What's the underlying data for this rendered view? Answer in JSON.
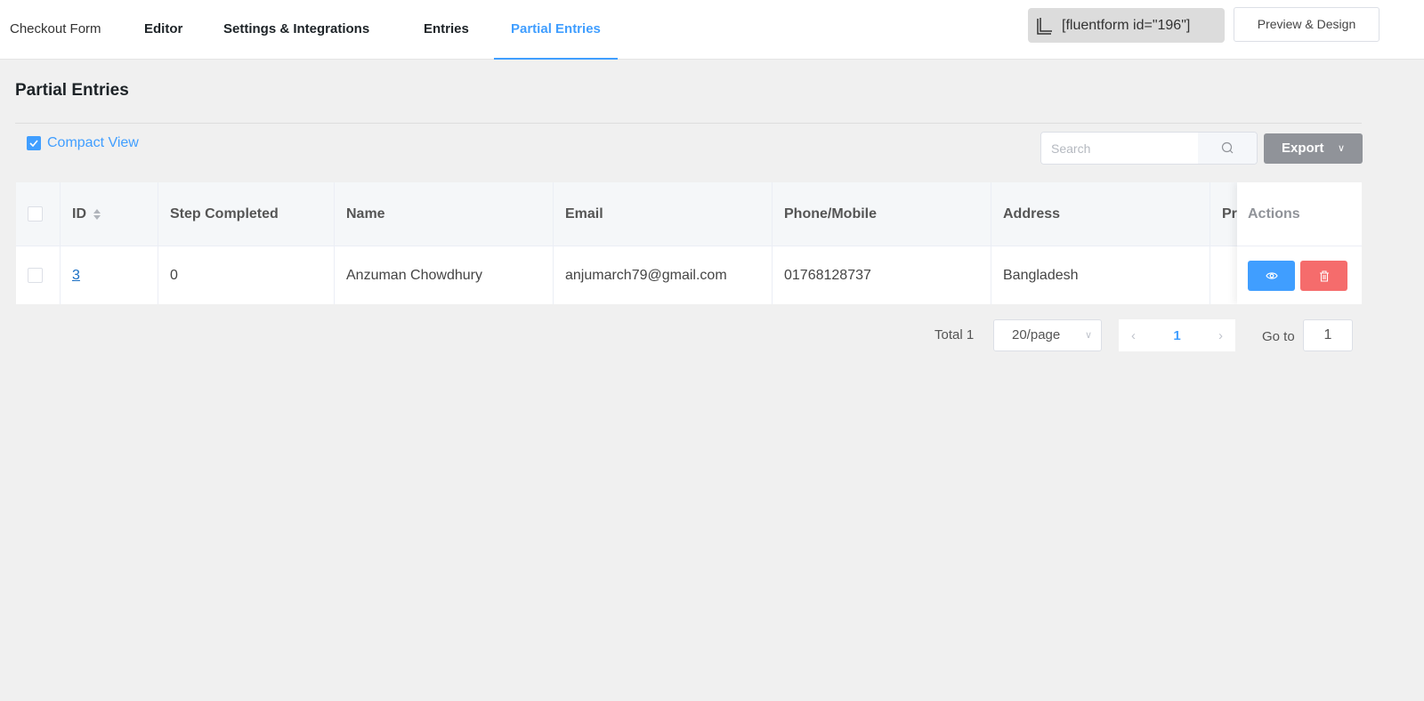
{
  "nav": {
    "form_name": "Checkout Form",
    "tabs": [
      "Editor",
      "Settings & Integrations",
      "Entries",
      "Partial Entries"
    ],
    "active_tab": "Partial Entries",
    "shortcode": "[fluentform id=\"196\"]",
    "preview_label": "Preview & Design"
  },
  "page": {
    "title": "Partial Entries",
    "compact_view_label": "Compact View",
    "compact_view_checked": true,
    "search_placeholder": "Search",
    "export_label": "Export"
  },
  "table": {
    "columns": [
      "ID",
      "Step Completed",
      "Name",
      "Email",
      "Phone/Mobile",
      "Address",
      "Pr",
      "Actions"
    ],
    "rows": [
      {
        "id": "3",
        "step": "0",
        "name": "Anzuman Chowdhury",
        "email": "anjumarch79@gmail.com",
        "phone": "01768128737",
        "address": "Bangladesh",
        "pr": ""
      }
    ]
  },
  "pagination": {
    "total": "Total 1",
    "page_size": "20/page",
    "current_page": "1",
    "goto_label": "Go to",
    "goto_value": "1"
  },
  "colors": {
    "accent": "#409eff",
    "danger": "#f56c6c",
    "export": "#909399"
  }
}
